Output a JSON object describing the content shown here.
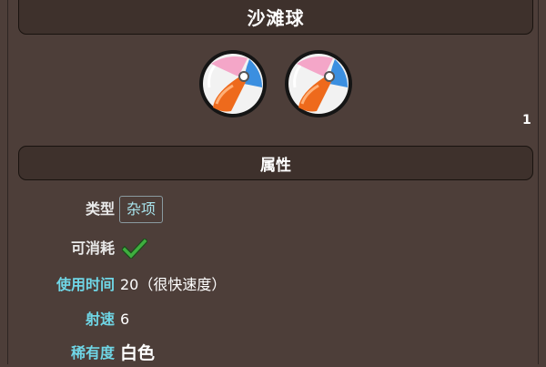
{
  "item": {
    "name": "沙滩球",
    "icon": "beach-ball-icon",
    "icon_count": 2,
    "stack_label": "1"
  },
  "section": {
    "title": "属性"
  },
  "properties": {
    "type_label": "类型",
    "type_value": "杂项",
    "consumable_label": "可消耗",
    "consumable_icon": "checkmark-icon",
    "use_time_label": "使用时间",
    "use_time_value": "20（很快速度）",
    "velocity_label": "射速",
    "velocity_value": "6",
    "rarity_label": "稀有度",
    "rarity_value": "白色"
  },
  "colors": {
    "background": "#4d3e39",
    "panel": "#3e312c",
    "label_cyan": "#6fd6e6",
    "tag_text": "#a8e3ec",
    "check_green": "#3fae3f"
  }
}
